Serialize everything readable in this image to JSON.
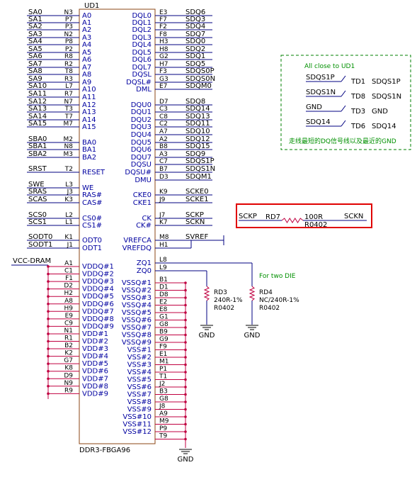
{
  "part": {
    "ref": "UD1",
    "value": "DDR3-FBGA96",
    "left_pins": [
      {
        "net": "SA0",
        "ball": "N3",
        "name": "A0"
      },
      {
        "net": "SA1",
        "ball": "P7",
        "name": "A1"
      },
      {
        "net": "SA2",
        "ball": "P3",
        "name": "A2"
      },
      {
        "net": "SA3",
        "ball": "N2",
        "name": "A3"
      },
      {
        "net": "SA4",
        "ball": "P8",
        "name": "A4"
      },
      {
        "net": "SA5",
        "ball": "P2",
        "name": "A5"
      },
      {
        "net": "SA6",
        "ball": "R8",
        "name": "A6"
      },
      {
        "net": "SA7",
        "ball": "R2",
        "name": "A7"
      },
      {
        "net": "SA8",
        "ball": "T8",
        "name": "A8"
      },
      {
        "net": "SA9",
        "ball": "R3",
        "name": "A9"
      },
      {
        "net": "SA10",
        "ball": "L7",
        "name": "A10"
      },
      {
        "net": "SA11",
        "ball": "R7",
        "name": "A11"
      },
      {
        "net": "SA12",
        "ball": "N7",
        "name": "A12"
      },
      {
        "net": "SA13",
        "ball": "T3",
        "name": "A13"
      },
      {
        "net": "SA14",
        "ball": "T7",
        "name": "A14"
      },
      {
        "net": "SA15",
        "ball": "M7",
        "name": "A15"
      },
      {
        "net": "SBA0",
        "ball": "M2",
        "name": "BA0"
      },
      {
        "net": "SBA1",
        "ball": "N8",
        "name": "BA1"
      },
      {
        "net": "SBA2",
        "ball": "M3",
        "name": "BA2"
      },
      {
        "net": "SRST",
        "ball": "T2",
        "name": "RESET"
      },
      {
        "net": "SWE",
        "ball": "L3",
        "name": "WE"
      },
      {
        "net": "SRAS",
        "ball": "J3",
        "name": "RAS#"
      },
      {
        "net": "SCAS",
        "ball": "K3",
        "name": "CAS#"
      },
      {
        "net": "SCS0",
        "ball": "L2",
        "name": "CS0#"
      },
      {
        "net": "SCS1",
        "ball": "L1",
        "name": "CS1#"
      },
      {
        "net": "SODT0",
        "ball": "K1",
        "name": "ODT0"
      },
      {
        "net": "SODT1",
        "ball": "J1",
        "name": "ODT1"
      }
    ],
    "right_pins": [
      {
        "net": "SDQ6",
        "ball": "E3",
        "name": "DQL0"
      },
      {
        "net": "SDQ3",
        "ball": "F7",
        "name": "DQL1"
      },
      {
        "net": "SDQ4",
        "ball": "F2",
        "name": "DQL2"
      },
      {
        "net": "SDQ7",
        "ball": "F8",
        "name": "DQL3"
      },
      {
        "net": "SDQ0",
        "ball": "H3",
        "name": "DQL4"
      },
      {
        "net": "SDQ2",
        "ball": "H8",
        "name": "DQL5"
      },
      {
        "net": "SDQ1",
        "ball": "G2",
        "name": "DQL6"
      },
      {
        "net": "SDQ5",
        "ball": "H7",
        "name": "DQL7"
      },
      {
        "net": "SDQS0P",
        "ball": "F3",
        "name": "DQSL"
      },
      {
        "net": "SDQS0N",
        "ball": "G3",
        "name": "DQSL#"
      },
      {
        "net": "SDQM0",
        "ball": "E7",
        "name": "DML"
      },
      {
        "net": "SDQ8",
        "ball": "D7",
        "name": "DQU0"
      },
      {
        "net": "SDQ14",
        "ball": "C3",
        "name": "DQU1"
      },
      {
        "net": "SDQ13",
        "ball": "C8",
        "name": "DQU2"
      },
      {
        "net": "SDQ11",
        "ball": "C2",
        "name": "DQU3"
      },
      {
        "net": "SDQ10",
        "ball": "A7",
        "name": "DQU4"
      },
      {
        "net": "SDQ12",
        "ball": "A2",
        "name": "DQU5"
      },
      {
        "net": "SDQ15",
        "ball": "B8",
        "name": "DQU6"
      },
      {
        "net": "SDQ9",
        "ball": "A3",
        "name": "DQU7"
      },
      {
        "net": "SDQS1P",
        "ball": "C7",
        "name": "DQSU"
      },
      {
        "net": "SDQS1N",
        "ball": "B7",
        "name": "DQSU#"
      },
      {
        "net": "SDQM1",
        "ball": "D3",
        "name": "DMU"
      },
      {
        "net": "SCKE0",
        "ball": "K9",
        "name": "CKE0"
      },
      {
        "net": "SCKE1",
        "ball": "J9",
        "name": "CKE1"
      },
      {
        "net": "SCKP",
        "ball": "J7",
        "name": "CK"
      },
      {
        "net": "SCKN",
        "ball": "K7",
        "name": "CK#"
      },
      {
        "net": "SVREF",
        "ball": "M8",
        "name": "VREFCA"
      },
      {
        "net": "",
        "ball": "H1",
        "name": "VREFDQ"
      },
      {
        "net": "",
        "ball": "L8",
        "name": "ZQ1"
      },
      {
        "net": "",
        "ball": "L9",
        "name": "ZQ0"
      }
    ],
    "vddq_pins": [
      {
        "ball": "A1",
        "name": "VDDQ#1"
      },
      {
        "ball": "C1",
        "name": "VDDQ#2"
      },
      {
        "ball": "F1",
        "name": "VDDQ#3"
      },
      {
        "ball": "D2",
        "name": "VDDQ#4"
      },
      {
        "ball": "H2",
        "name": "VDDQ#5"
      },
      {
        "ball": "A8",
        "name": "VDDQ#6"
      },
      {
        "ball": "H9",
        "name": "VDDQ#7"
      },
      {
        "ball": "E9",
        "name": "VDDQ#8"
      },
      {
        "ball": "C9",
        "name": "VDDQ#9"
      }
    ],
    "vdd_pins": [
      {
        "ball": "N1",
        "name": "VDD#1"
      },
      {
        "ball": "R1",
        "name": "VDD#2"
      },
      {
        "ball": "B2",
        "name": "VDD#3"
      },
      {
        "ball": "K2",
        "name": "VDD#4"
      },
      {
        "ball": "G7",
        "name": "VDD#5"
      },
      {
        "ball": "K8",
        "name": "VDD#6"
      },
      {
        "ball": "D9",
        "name": "VDD#7"
      },
      {
        "ball": "N9",
        "name": "VDD#8"
      },
      {
        "ball": "R9",
        "name": "VDD#9"
      }
    ],
    "vssq_pins": [
      {
        "ball": "B1",
        "name": "VSSQ#1"
      },
      {
        "ball": "D1",
        "name": "VSSQ#2"
      },
      {
        "ball": "D8",
        "name": "VSSQ#3"
      },
      {
        "ball": "E2",
        "name": "VSSQ#4"
      },
      {
        "ball": "E8",
        "name": "VSSQ#5"
      },
      {
        "ball": "G1",
        "name": "VSSQ#6"
      },
      {
        "ball": "G8",
        "name": "VSSQ#7"
      },
      {
        "ball": "B9",
        "name": "VSSQ#8"
      },
      {
        "ball": "G9",
        "name": "VSSQ#9"
      }
    ],
    "vss_pins": [
      {
        "ball": "F9",
        "name": "VSS#1"
      },
      {
        "ball": "E1",
        "name": "VSS#2"
      },
      {
        "ball": "M1",
        "name": "VSS#3"
      },
      {
        "ball": "P1",
        "name": "VSS#4"
      },
      {
        "ball": "T1",
        "name": "VSS#5"
      },
      {
        "ball": "J2",
        "name": "VSS#6"
      },
      {
        "ball": "B3",
        "name": "VSS#7"
      },
      {
        "ball": "G8",
        "name": "VSS#8"
      },
      {
        "ball": "J8",
        "name": "VSS#9"
      },
      {
        "ball": "A9",
        "name": "VSS#10"
      },
      {
        "ball": "M9",
        "name": "VSS#11"
      },
      {
        "ball": "P9",
        "name": "VSS#12"
      },
      {
        "ball": "T9",
        "name": ""
      }
    ]
  },
  "power": {
    "vcc_label": "VCC-DRAM",
    "gnd_label": "GND"
  },
  "zq": {
    "note": "For two DIE",
    "r3": {
      "ref": "RD3",
      "value": "240R-1%",
      "package": "R0402"
    },
    "r4": {
      "ref": "RD4",
      "value": "NC/240R-1%",
      "package": "R0402"
    }
  },
  "dq_box": {
    "title": "All close to UD1",
    "rows": [
      {
        "net": "SDQS1P",
        "tp": "TD1",
        "label": "SDQS1P"
      },
      {
        "net": "SDQS1N",
        "tp": "TD8",
        "label": "SDQS1N"
      },
      {
        "net": "GND",
        "tp": "TD3",
        "label": "GND"
      },
      {
        "net": "SDQ14",
        "tp": "TD6",
        "label": "SDQ14"
      }
    ],
    "note": "走线最短的DQ信号线以及最近的GND"
  },
  "clk_term": {
    "left_net": "SCKP",
    "ref": "RD7",
    "value": "100R",
    "right_net": "SCKN",
    "package": "R0402"
  },
  "colors": {
    "wire": "#000080",
    "pin_text": "#0000a0",
    "rail": "#c00040",
    "note": "#009000",
    "box": "#e00000",
    "dash": "#008000"
  }
}
